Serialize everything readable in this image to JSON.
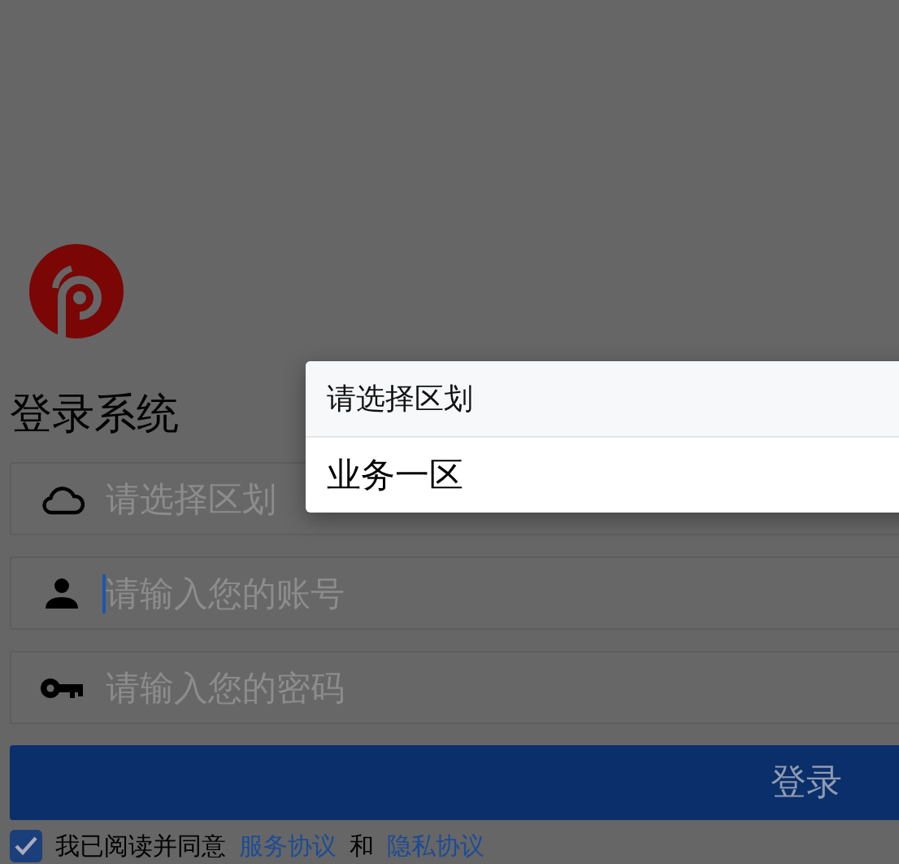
{
  "title": "登录系统",
  "fields": [
    {
      "kind": "select",
      "placeholder": "请选择区划",
      "focused": false
    },
    {
      "kind": "account",
      "placeholder": "请输入您的账号",
      "focused": true
    },
    {
      "kind": "password",
      "placeholder": "请输入您的密码",
      "focused": false
    }
  ],
  "login_button": "登录",
  "agreement": {
    "checked": true,
    "text": "我已阅读并同意",
    "links": [
      {
        "label": "服务协议"
      },
      {
        "label": "隐私协议"
      }
    ],
    "joiner": "和"
  },
  "picker": {
    "title": "请选择区划",
    "options": [
      {
        "label": "业务一区"
      }
    ]
  }
}
